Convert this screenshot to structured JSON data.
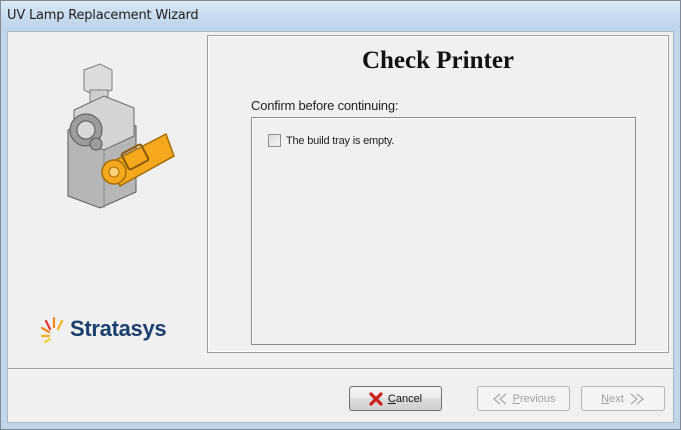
{
  "window": {
    "title": "UV Lamp Replacement Wizard"
  },
  "branding": {
    "logo_text": "Stratasys",
    "logo_icon": "stratasys-star-icon",
    "illustration": "uv-lamp-illustration"
  },
  "page": {
    "title": "Check Printer",
    "instruction": "Confirm before continuing:",
    "checklist": [
      {
        "label": "The build tray is empty.",
        "checked": false
      }
    ]
  },
  "buttons": {
    "cancel": {
      "mnemonic": "C",
      "rest": "ancel",
      "icon": "red-x-icon",
      "enabled": true
    },
    "previous": {
      "mnemonic": "P",
      "rest": "revious",
      "icon": "chevron-left-icon",
      "enabled": false
    },
    "next": {
      "mnemonic": "N",
      "rest": "ext",
      "icon": "chevron-right-icon",
      "enabled": false
    }
  },
  "colors": {
    "titlebar": "#c9dcef",
    "client": "#f0f0f0",
    "logo_text": "#1b3f6f",
    "lamp_handle": "#f4a81d",
    "cancel_icon": "#cc1f1a"
  }
}
